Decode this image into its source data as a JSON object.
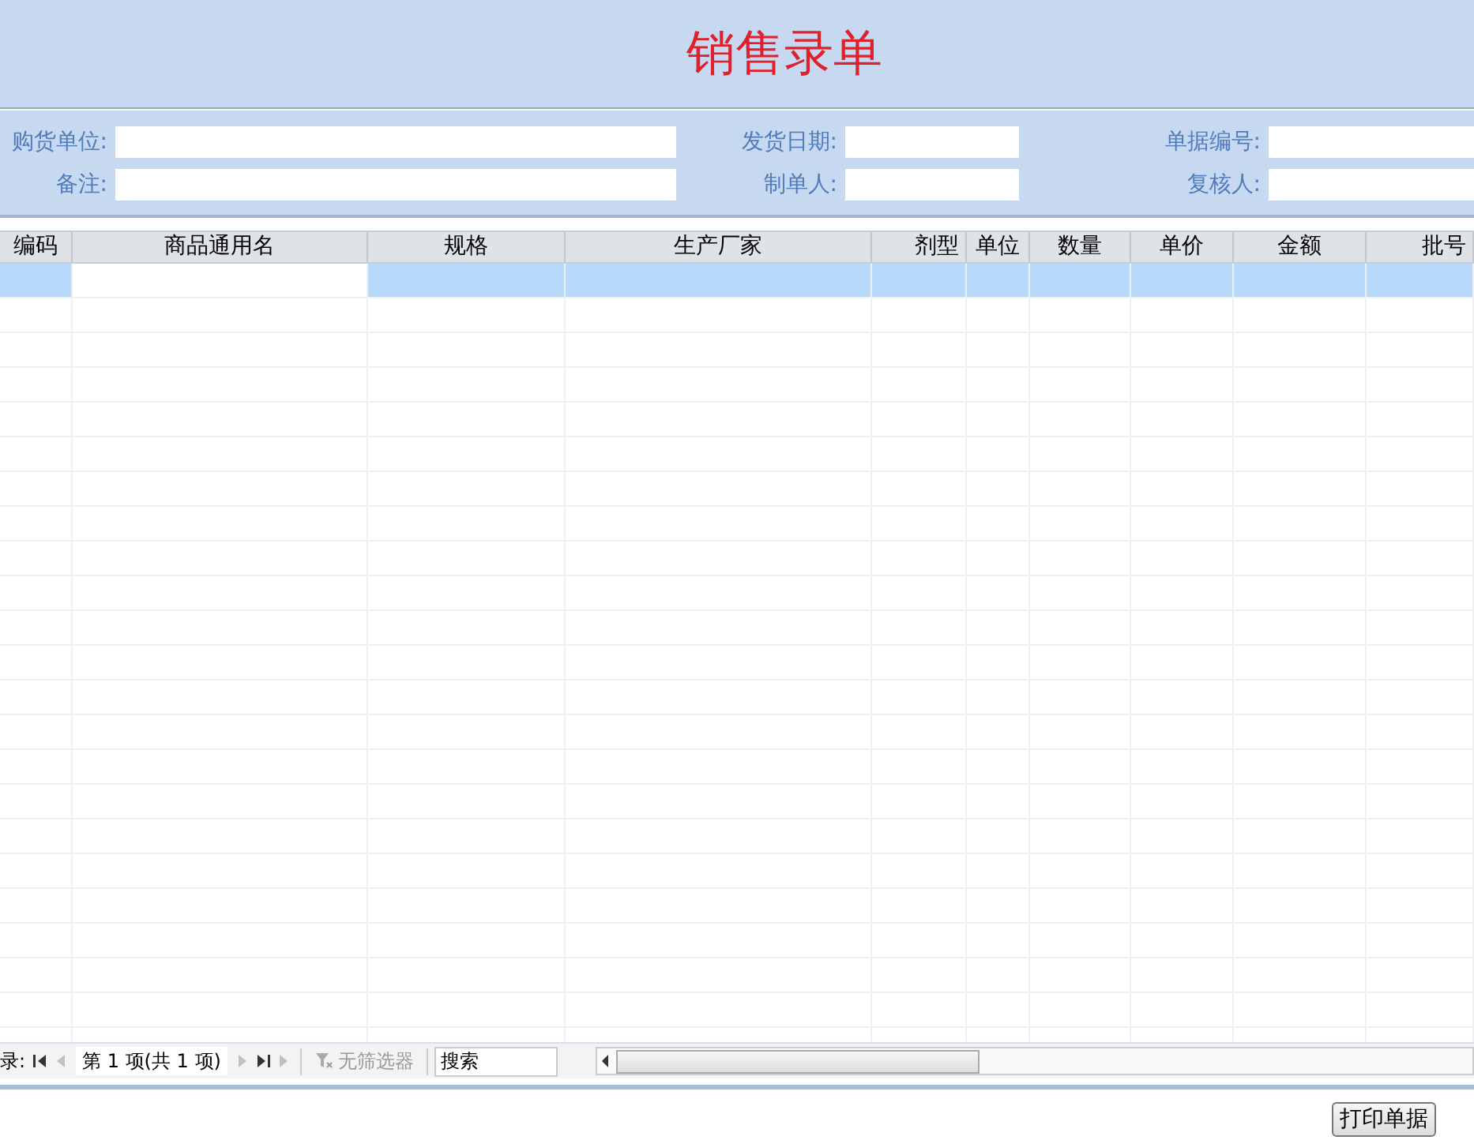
{
  "title": "销售录单",
  "form": [
    {
      "label": "购货单位:"
    },
    {
      "label": "发货日期:"
    },
    {
      "label": "单据编号:"
    },
    {
      "label": "备注:"
    },
    {
      "label": "制单人:"
    },
    {
      "label": "复核人:"
    }
  ],
  "table": {
    "columns": [
      {
        "label": "编码"
      },
      {
        "label": "商品通用名"
      },
      {
        "label": "规格"
      },
      {
        "label": "生产厂家"
      },
      {
        "label": "剂型"
      },
      {
        "label": "单位"
      },
      {
        "label": "数量"
      },
      {
        "label": "单价"
      },
      {
        "label": "金额"
      },
      {
        "label": "批号"
      }
    ],
    "rows": [
      {
        "selected": true,
        "cells": [
          {
            "current": false
          },
          {
            "current": true
          },
          {
            "current": false
          },
          {
            "current": false
          },
          {
            "current": false
          },
          {
            "current": false
          },
          {
            "current": false
          },
          {
            "current": false
          },
          {
            "current": false
          },
          {
            "current": false
          }
        ]
      }
    ]
  },
  "navigator": {
    "label": "录:",
    "buttons": [
      {
        "kind": "first",
        "disabled": false
      },
      {
        "kind": "prev",
        "disabled": true
      }
    ],
    "position": "第 1 项(共 1 项)",
    "buttons_after": [
      {
        "kind": "next",
        "disabled": true
      },
      {
        "kind": "last",
        "disabled": false
      },
      {
        "kind": "new",
        "disabled": true
      }
    ],
    "filter": {
      "label": "无筛选器",
      "disabled": true
    },
    "search": {
      "placeholder": "搜索"
    }
  },
  "print_button": "打印单据"
}
